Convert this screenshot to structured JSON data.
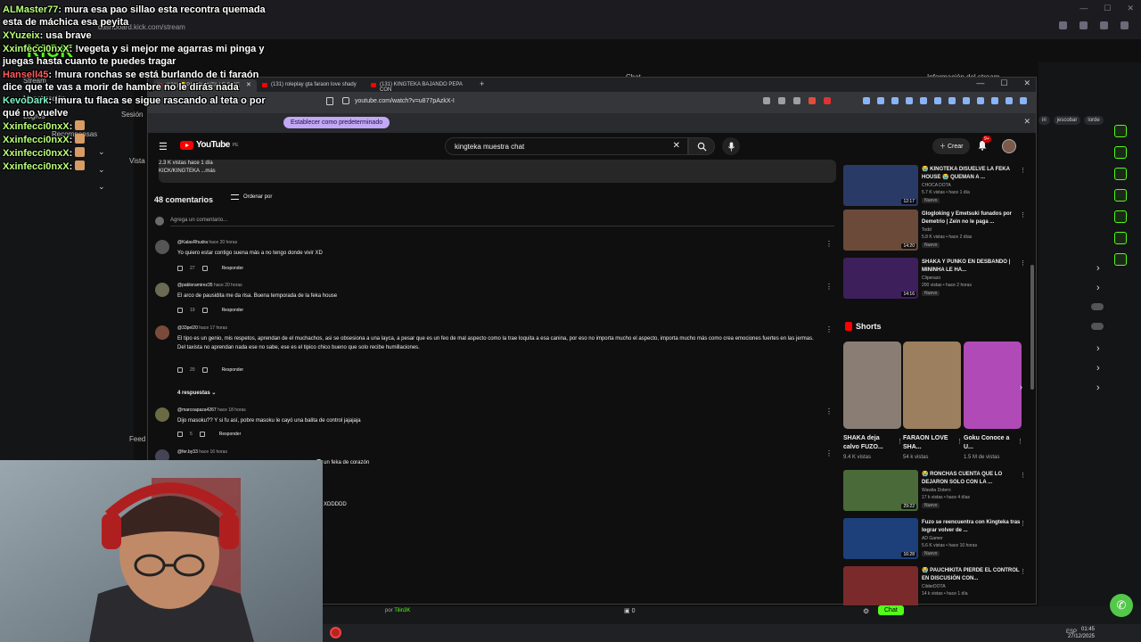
{
  "background": {
    "url_text": "dashboard.kick.com/stream",
    "kick_logo": "KICK",
    "kick_nav": [
      "Stream",
      "Monetización",
      "Logros",
      "Sesión",
      "Recompensas",
      "Vista",
      "Feed"
    ],
    "right_labels": [
      "Chat",
      "Información del stream"
    ],
    "user_chips": [
      "iri",
      "jescobar",
      "lorde"
    ],
    "chat_button": "Chat",
    "viewer_count": "0",
    "credit_prefix": "por",
    "credit_user": "Tilin3K",
    "taskbar_lang": "ESP",
    "taskbar_time": "01:45",
    "taskbar_date": "27/12/2025"
  },
  "chat": [
    {
      "user": "ALMaster77",
      "text": ": mura esa pao sillao esta recontra quemada esta de máchica esa peyita",
      "color": "green"
    },
    {
      "user": "XYuzeix",
      "text": ": usa brave",
      "color": "green"
    },
    {
      "user": "Xxinfecci0nxX",
      "text": ": !vegeta y si mejor me agarras mi pinga y juegas hasta cuanto te puedes tragar",
      "color": "green"
    },
    {
      "user": "Hansell45",
      "text": ": !mura ronchas se está burlando de ti faraón dice que te vas a morir de hambre no le dirás nada",
      "color": "red"
    },
    {
      "user": "KevoDark",
      "text": ": !mura tu flaca se sigue rascando al teta o por qué no vuelve",
      "color": "teal"
    },
    {
      "user": "Xxinfecci0nxX",
      "text": ":",
      "color": "green",
      "emote": true
    },
    {
      "user": "Xxinfecci0nxX",
      "text": ":",
      "color": "green",
      "emote": true
    },
    {
      "user": "Xxinfecci0nxX",
      "text": ":",
      "color": "green",
      "emote": true
    },
    {
      "user": "Xxinfecci0nxX",
      "text": ":",
      "color": "green",
      "emote": true
    }
  ],
  "browser": {
    "tabs": [
      {
        "label": "(131) 😭PAUCHIKITA LE DICE",
        "active": true
      },
      {
        "label": "(131) roleplay gta faraon love shady",
        "active": false
      },
      {
        "label": "(131) KINGTEKA BAJANDO PEPA CON",
        "active": false
      }
    ],
    "address": "youtube.com/watch?v=u877pAzkX-I",
    "set_default_label": "Establecer como predeterminado"
  },
  "youtube": {
    "logo": "YouTube",
    "logo_region": "PE",
    "search_value": "kingteka muestra chat",
    "create_label": "Crear",
    "notif_badge": "9+",
    "description": {
      "views": "2.3 K vistas  hace 1 día",
      "line": "KICK/KINGTEKA ...más"
    },
    "comments_count": "48 comentarios",
    "sort_label": "Ordenar por",
    "add_comment_placeholder": "Agrega un comentario...",
    "reply_label": "Responder",
    "comments": [
      {
        "user": "@KalasRhudra",
        "time": "hace 20 horas",
        "text": "Yo quiero estar contigo suena más a no tengo donde vivir XD",
        "likes": "27"
      },
      {
        "user": "@pabloramirez35",
        "time": "hace 20 horas",
        "text": "El arco de pausidita me da risa. Buena temporada de la feka house",
        "likes": "19"
      },
      {
        "user": "@33pel20",
        "time": "hace 17 horas",
        "text": "El tipo es un genio, mis respetos, aprendan de el muchachos, asi se obsesiona a una layca, a pesar que es un feo de mal aspecto como la trae loquita a esa canina, por eso no importa mucho el aspecto, importa mucho más como crea emociones fuertes en las jermas.\nDel taxista no aprendan nada ese no sabe, ese es el tipico chico bueno que solo recibe humillaciones.",
        "likes": "20"
      },
      {
        "user": "@marcoapaza4267",
        "time": "hace 18 horas",
        "text": "Dijo masoku?? Y si fu así, pobre masoku le cayó una balita de control jajajaja",
        "likes": "5"
      },
      {
        "user": "@fer.by33",
        "time": "hace 16 horas",
        "text": "😄 un feka de corazón",
        "likes": ""
      }
    ],
    "replies_label": "4 respuestas",
    "partial_text": "XDDDDD",
    "shorts_label": "Shorts",
    "recommendations_top": [
      {
        "title": "😭 KINGTEKA DISUELVE LA FEKA HOUSE 😭 QUEMAN A ...",
        "channel": "CHOCA DOTA",
        "meta": "5.7 K vistas • hace 1 día",
        "duration": "12:17",
        "new": "Nuevo",
        "thumb_color": "#2a3a66"
      },
      {
        "title": "Glogloking y Emetsuki funados por Demetrio | Zein no le paga ...",
        "channel": "Todd",
        "meta": "5.8 K vistas • hace 2 días",
        "duration": "14:20",
        "new": "Nuevo",
        "thumb_color": "#6b4a3a"
      },
      {
        "title": "SHAKA Y PUNKO EN DESBANDO | MININHA LE HA...",
        "channel": "Cliperazo",
        "meta": "200 vistas • hace 2 horas",
        "duration": "14:16",
        "new": "Nuevo",
        "thumb_color": "#3d1f5c"
      }
    ],
    "shorts": [
      {
        "title": "SHAKA deja calvo FUZO...",
        "views": "9.4 K vistas",
        "thumb_color": "#8a7e74"
      },
      {
        "title": "FARAON LOVE SHA...",
        "views": "54 k vistas",
        "thumb_color": "#9c7f5e"
      },
      {
        "title": "Goku Conoce a U...",
        "views": "1.5 M de vistas",
        "thumb_color": "#b04ab6"
      }
    ],
    "recommendations_bottom": [
      {
        "title": "😭 RONCHAS CUENTA QUE LO DEJARON SOLO CON LA ...",
        "channel": "Wawita Dotero",
        "meta": "17 k vistas • hace 4 días",
        "duration": "29:22",
        "new": "Nuevo",
        "thumb_color": "#4a6a3a"
      },
      {
        "title": "Fuzo se reencuentra con Kingteka tras lograr volver de ...",
        "channel": "AD Gamer",
        "meta": "5.6 K vistas • hace 10 horas",
        "duration": "16:28",
        "new": "Nuevo",
        "thumb_color": "#1d3f7a"
      },
      {
        "title": "😭 PAUCHIKITA PIERDE EL CONTROL EN DISCUSIÓN CON...",
        "channel": "CilderDOTA",
        "meta": "14 k vistas • hace 1 día",
        "duration": "",
        "new": "",
        "thumb_color": "#7a2a2a"
      }
    ]
  }
}
